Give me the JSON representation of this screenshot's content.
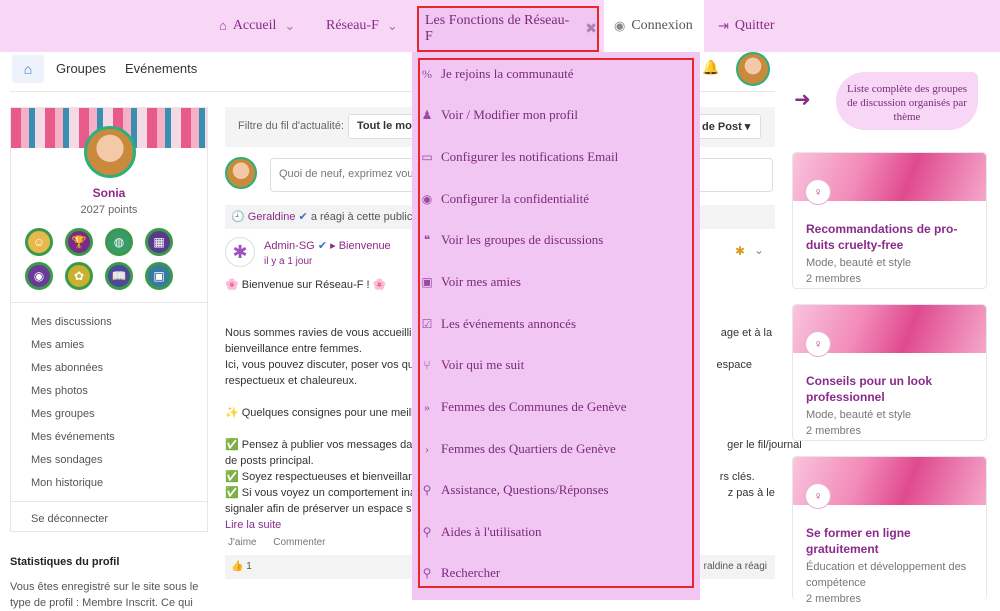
{
  "topnav": {
    "accueil": "Accueil",
    "reseau": "Réseau-F",
    "fonctions": "Les Fonctions de Réseau-F",
    "connexion": "Connexion",
    "quitter": "Quitter"
  },
  "subnav": {
    "groupes": "Groupes",
    "evenements": "Evénements"
  },
  "profile": {
    "name": "Sonia",
    "points": "2027 points"
  },
  "left_menu": {
    "items": [
      "Mes discussions",
      "Mes amies",
      "Mes abonnées",
      "Mes photos",
      "Mes groupes",
      "Mes événements",
      "Mes sondages",
      "Mon historique"
    ],
    "logout": "Se déconnecter"
  },
  "stats": {
    "title": "Statistiques du profil",
    "text": "Vous êtes enregistré sur le site sous le type de profil : Membre Inscrit. Ce qui"
  },
  "feed": {
    "filter_label": "Filtre du fil d'actualité:",
    "filter_value": "Tout le mon",
    "sort_value": "de Post",
    "composer_placeholder": "Quoi de neuf, exprimez vous",
    "activity_who": "Geraldine",
    "activity_text": "a réagi à cette public",
    "post_author": "Admin-SG",
    "post_group": "Bienvenue",
    "post_time": "il y a 1 jour",
    "post_lines": [
      "🌸 Bienvenue sur Réseau-F ! 🌸",
      "",
      "Nous sommes ravies de vous accueillir                                                                                                    age et à la",
      "bienveillance entre femmes.",
      "Ici, vous pouvez discuter, poser vos que                                                                                                 espace",
      "respectueux et chaleureux.",
      "",
      "✨ Quelques consignes pour une meille",
      "",
      "✅ Pensez à publier vos messages dan                                                                                                     ger le fil/journal",
      "de posts principal.",
      "✅ Soyez respectueuses et bienveillant                                                                                                   rs clés.",
      "✅ Si vous voyez un comportement inap                                                                                                    z pas à le",
      "signaler afin de préserver un espace sû"
    ],
    "read_more": "Lire la suite",
    "like_label": "J'aime",
    "comment_label": "Commenter",
    "likes_count": "1",
    "reacted_text": "raldine a réagi"
  },
  "dropdown": {
    "items": [
      {
        "icon": "link-icon",
        "glyph": "%",
        "label": "Je rejoins la communauté"
      },
      {
        "icon": "user-icon",
        "glyph": "👤",
        "label": "Voir / Modifier mon profil"
      },
      {
        "icon": "window-icon",
        "glyph": "▭",
        "label": "Configurer les notifications Email"
      },
      {
        "icon": "user-circle-icon",
        "glyph": "◉",
        "label": "Configurer la confidentialité"
      },
      {
        "icon": "comments-icon",
        "glyph": "💬",
        "label": "Voir les groupes de discussions"
      },
      {
        "icon": "address-card-icon",
        "glyph": "▣",
        "label": "Voir mes amies"
      },
      {
        "icon": "calendar-check-icon",
        "glyph": "☑",
        "label": "Les événements annoncés"
      },
      {
        "icon": "code-branch-icon",
        "glyph": "⑂",
        "label": "Voir qui me suit"
      },
      {
        "icon": "double-angle-right-icon",
        "glyph": "»",
        "label": "Femmes des Communes de Genève"
      },
      {
        "icon": "angle-right-icon",
        "glyph": "›",
        "label": "Femmes des Quartiers de Genève"
      },
      {
        "icon": "search-icon",
        "glyph": "🔍",
        "label": "Assistance, Questions/Réponses"
      },
      {
        "icon": "search-icon",
        "glyph": "🔍",
        "label": "Aides à l'utilisation"
      },
      {
        "icon": "search-icon",
        "glyph": "🔍",
        "label": "Rechercher"
      }
    ]
  },
  "promo": {
    "text": "Liste complète des groupes de discussion organisés par thème"
  },
  "groups": [
    {
      "title": "Recommandations de pro-duits cruelty-free",
      "category": "Mode, beauté et style",
      "members": "2 membres"
    },
    {
      "title": "Conseils pour un look professionnel",
      "category": "Mode, beauté et style",
      "members": "2 membres"
    },
    {
      "title": "Se former en ligne gratuitement",
      "category": "Éducation et développement des compétence",
      "members": "2 membres"
    }
  ],
  "colors": {
    "brand_purple": "#8a2b8a",
    "menu_bg": "#f2c6f2",
    "topbar_bg": "#f7d6f6",
    "highlight_red": "#e8262b"
  }
}
